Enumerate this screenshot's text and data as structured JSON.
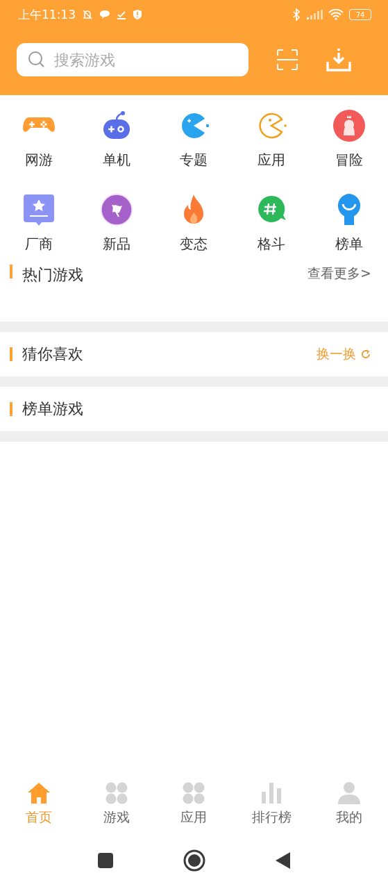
{
  "status_bar": {
    "time": "上午11:13",
    "battery": "74"
  },
  "search": {
    "placeholder": "搜索游戏"
  },
  "categories": [
    {
      "label": "网游",
      "kind": "gamepad"
    },
    {
      "label": "单机",
      "kind": "joystick"
    },
    {
      "label": "专题",
      "kind": "pacman-solid"
    },
    {
      "label": "应用",
      "kind": "pacman-outline"
    },
    {
      "label": "冒险",
      "kind": "mascot"
    },
    {
      "label": "厂商",
      "kind": "star-badge"
    },
    {
      "label": "新品",
      "kind": "flag"
    },
    {
      "label": "变态",
      "kind": "flame"
    },
    {
      "label": "格斗",
      "kind": "hash-bubble"
    },
    {
      "label": "榜单",
      "kind": "pin"
    }
  ],
  "sections": [
    {
      "title": "热门游戏",
      "action": {
        "label": "查看更多>",
        "kind": "more"
      }
    },
    {
      "title": "猜你喜欢",
      "action": {
        "label": "换一换",
        "kind": "refresh"
      }
    },
    {
      "title": "榜单游戏"
    }
  ],
  "bottom_nav": [
    {
      "label": "首页",
      "kind": "home",
      "selected": true
    },
    {
      "label": "游戏",
      "kind": "grid",
      "selected": false
    },
    {
      "label": "应用",
      "kind": "grid",
      "selected": false
    },
    {
      "label": "排行榜",
      "kind": "bars",
      "selected": false
    },
    {
      "label": "我的",
      "kind": "person",
      "selected": false
    }
  ]
}
